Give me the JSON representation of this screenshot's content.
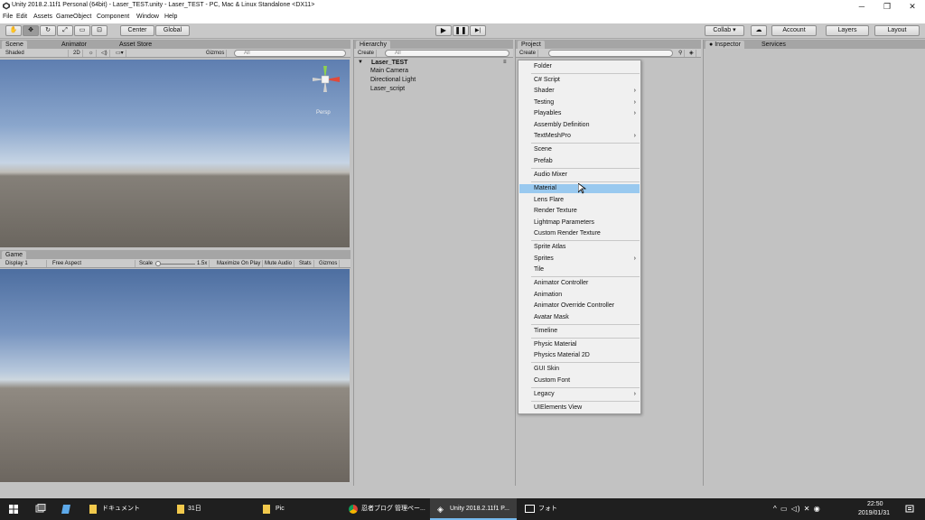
{
  "window": {
    "title": "Unity 2018.2.11f1 Personal (64bit) - Laser_TEST.unity - Laser_TEST - PC, Mac & Linux Standalone <DX11>",
    "minimize": "─",
    "restore": "❐",
    "close": "✕"
  },
  "menubar": [
    "File",
    "Edit",
    "Assets",
    "GameObject",
    "Component",
    "Window",
    "Help"
  ],
  "toolbar": {
    "tools": [
      "✋",
      "✥",
      "↻",
      "⤢",
      "▭",
      "⊡"
    ],
    "pivot": "Center",
    "space": "Global",
    "play": "▶",
    "pause": "❚❚",
    "step": "▶|",
    "collab": "Collab ▾",
    "cloud": "☁",
    "account": "Account",
    "layers": "Layers",
    "layout": "Layout"
  },
  "scene_panel": {
    "tabs": [
      "Scene",
      "Animator",
      "Asset Store"
    ],
    "shading": "Shaded",
    "mode2d": "2D",
    "gizmos": "Gizmos",
    "search_placeholder": "All",
    "persp_label": "Persp"
  },
  "game_panel": {
    "tab": "Game",
    "display": "Display 1",
    "aspect": "Free Aspect",
    "scale_label": "Scale",
    "scale_value": "1.5x",
    "maximize": "Maximize On Play",
    "mute": "Mute Audio",
    "stats": "Stats",
    "gizmos": "Gizmos"
  },
  "hierarchy": {
    "tab": "Hierarchy",
    "create": "Create",
    "search_placeholder": "All",
    "scene_name": "Laser_TEST",
    "items": [
      "Main Camera",
      "Directional Light",
      "Laser_script"
    ]
  },
  "project": {
    "tab": "Project",
    "create": "Create"
  },
  "inspector": {
    "tabs": [
      "Inspector",
      "Services"
    ]
  },
  "create_menu": {
    "items": [
      {
        "label": "Folder"
      },
      {
        "label": "C# Script"
      },
      {
        "label": "Shader",
        "submenu": true
      },
      {
        "label": "Testing",
        "submenu": true
      },
      {
        "label": "Playables",
        "submenu": true
      },
      {
        "label": "Assembly Definition"
      },
      {
        "label": "TextMeshPro",
        "submenu": true
      },
      {
        "label": "Scene"
      },
      {
        "label": "Prefab"
      },
      {
        "label": "Audio Mixer"
      },
      {
        "label": "Material",
        "highlighted": true
      },
      {
        "label": "Lens Flare"
      },
      {
        "label": "Render Texture"
      },
      {
        "label": "Lightmap Parameters"
      },
      {
        "label": "Custom Render Texture"
      },
      {
        "label": "Sprite Atlas"
      },
      {
        "label": "Sprites",
        "submenu": true
      },
      {
        "label": "Tile"
      },
      {
        "label": "Animator Controller"
      },
      {
        "label": "Animation"
      },
      {
        "label": "Animator Override Controller"
      },
      {
        "label": "Avatar Mask"
      },
      {
        "label": "Timeline"
      },
      {
        "label": "Physic Material"
      },
      {
        "label": "Physics Material 2D"
      },
      {
        "label": "GUI Skin"
      },
      {
        "label": "Custom Font"
      },
      {
        "label": "Legacy",
        "submenu": true
      },
      {
        "label": "UIElements View"
      }
    ],
    "arrow": "›"
  },
  "taskbar": {
    "items": [
      "ドキュメント",
      "31日",
      "Pic",
      "忍者ブログ 管理ペー...",
      "Unity 2018.2.11f1 P...",
      "フォト"
    ],
    "time": "22:50",
    "date": "2019/01/31",
    "tray_icons": "^  ▭  ◁)  ✕  ◉"
  },
  "colors": {
    "accent_highlight": "#99c9ef",
    "taskbar": "#1f1f1f",
    "editor_bg": "#c2c2c2"
  }
}
